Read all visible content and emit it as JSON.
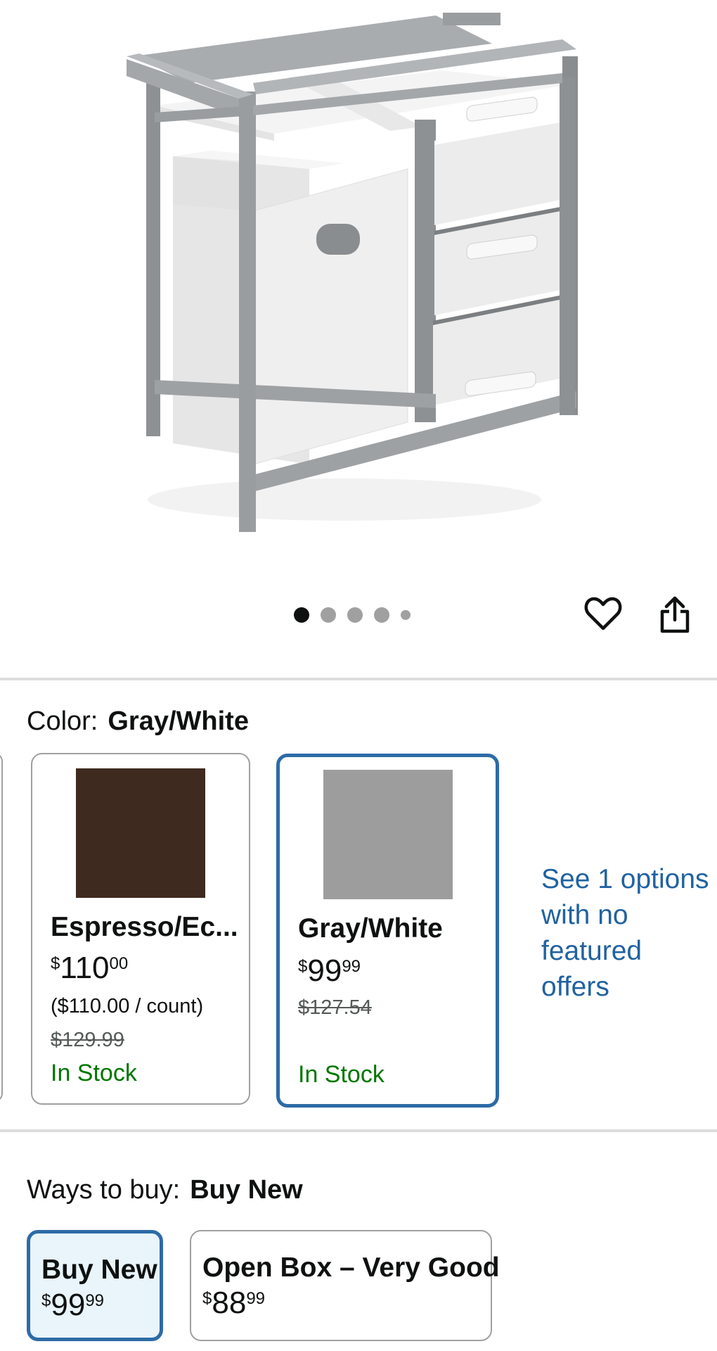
{
  "gallery": {
    "dot_count": 5,
    "active_dot": 1
  },
  "actions": {
    "favorite_icon": "heart-icon",
    "share_icon": "share-icon"
  },
  "color_selector": {
    "label": "Color:",
    "selected_value": "Gray/White",
    "options": [
      {
        "name": "Espresso/Ec...",
        "swatch_color": "#3f2a1f",
        "price_currency": "$",
        "price_whole": "110",
        "price_fraction": "00",
        "unit_price": "($110.00 / count)",
        "list_price": "$129.99",
        "stock": "In Stock",
        "selected": false
      },
      {
        "name": "Gray/White",
        "swatch_color": "#9d9d9d",
        "price_currency": "$",
        "price_whole": "99",
        "price_fraction": "99",
        "unit_price": "",
        "list_price": "$127.54",
        "stock": "In Stock",
        "selected": true
      }
    ],
    "see_options_link": "See 1 options with no featured offers"
  },
  "ways_to_buy": {
    "label": "Ways to buy:",
    "selected_value": "Buy New",
    "options": [
      {
        "name": "Buy New",
        "price_currency": "$",
        "price_whole": "99",
        "price_fraction": "99",
        "selected": true
      },
      {
        "name": "Open Box – Very Good",
        "price_currency": "$",
        "price_whole": "88",
        "price_fraction": "99",
        "selected": false
      }
    ]
  },
  "colors": {
    "accent_blue": "#2d6ba7",
    "link_blue": "#2162a1",
    "in_stock_green": "#007600",
    "frame_gray": "#8e9194"
  }
}
